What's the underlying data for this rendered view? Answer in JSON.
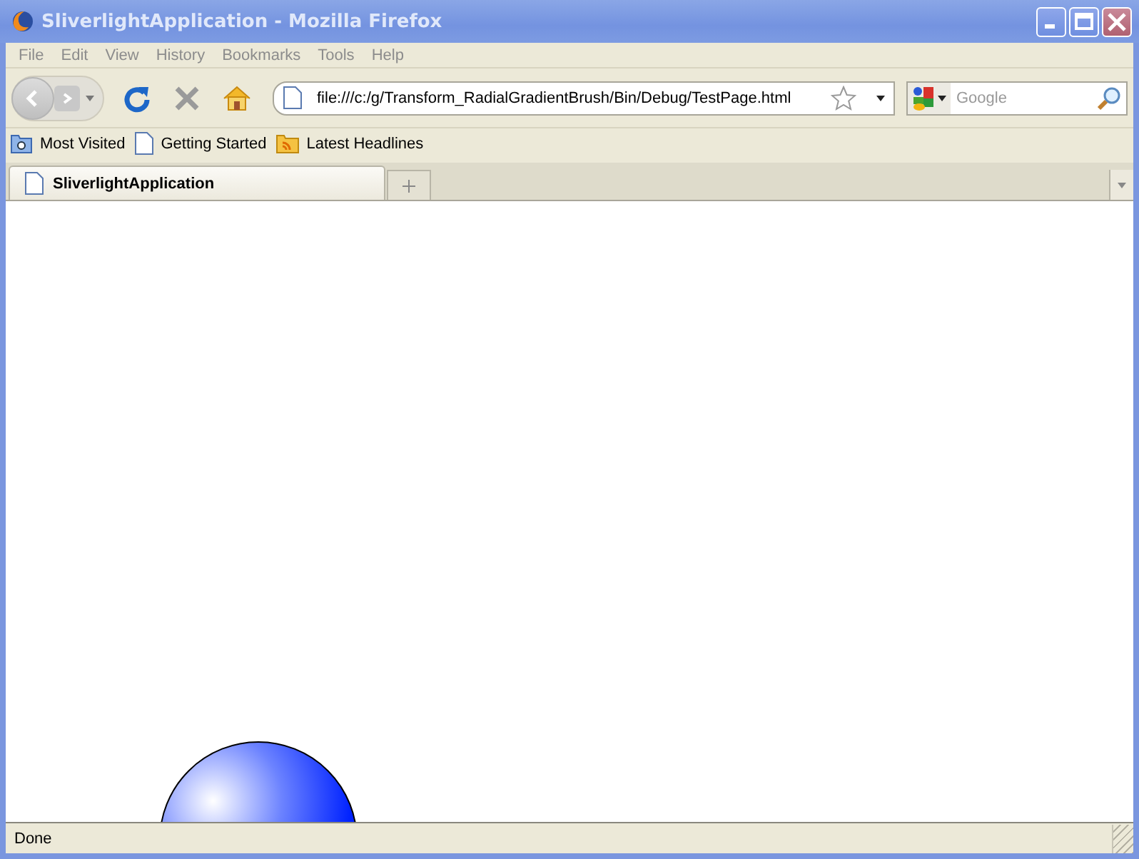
{
  "window": {
    "title": "SliverlightApplication - Mozilla Firefox"
  },
  "menu": [
    "File",
    "Edit",
    "View",
    "History",
    "Bookmarks",
    "Tools",
    "Help"
  ],
  "address": {
    "value": "file:///c:/g/Transform_RadialGradientBrush/Bin/Debug/TestPage.html"
  },
  "search": {
    "placeholder": "Google"
  },
  "bookmarks": [
    {
      "label": "Most Visited",
      "kind": "folder"
    },
    {
      "label": "Getting Started",
      "kind": "page"
    },
    {
      "label": "Latest Headlines",
      "kind": "feed"
    }
  ],
  "tabs": [
    {
      "label": "SliverlightApplication",
      "selected": true
    }
  ],
  "status_bar": {
    "text": "Done"
  }
}
